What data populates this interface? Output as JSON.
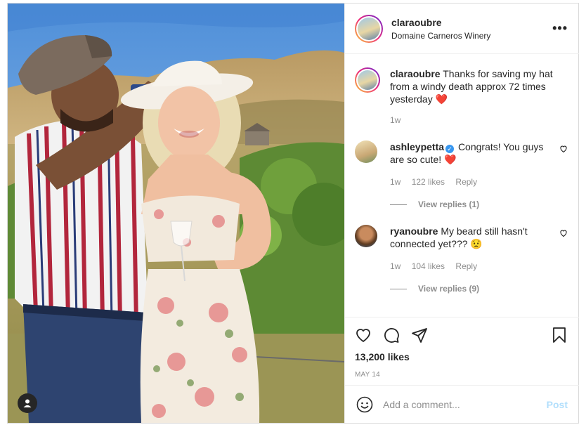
{
  "post": {
    "username": "claraoubre",
    "location": "Domaine Carneros Winery",
    "more_icon": "more-options-icon",
    "caption": {
      "username": "claraoubre",
      "text": "Thanks for saving my hat from a windy death approx 72 times yesterday",
      "emoji": "❤️",
      "time": "1w"
    },
    "comments": [
      {
        "username": "ashleypetta",
        "verified": true,
        "text": "Congrats! You guys are so cute!",
        "emoji": "❤️",
        "time": "1w",
        "likes": "122 likes",
        "reply_label": "Reply",
        "view_replies": "View replies (1)"
      },
      {
        "username": "ryanoubre",
        "verified": false,
        "text": "My beard still hasn't connected yet???",
        "emoji": "😟",
        "time": "1w",
        "likes": "104 likes",
        "reply_label": "Reply",
        "view_replies": "View replies (9)"
      }
    ],
    "likes_count": "13,200 likes",
    "date": "MAY 14",
    "add_comment_placeholder": "Add a comment...",
    "post_button": "Post"
  },
  "colors": {
    "accent_blue": "#0095f6",
    "post_disabled": "#b2dffc",
    "meta_gray": "#8e8e8e",
    "text": "#262626",
    "heart_red": "#ed4956"
  }
}
